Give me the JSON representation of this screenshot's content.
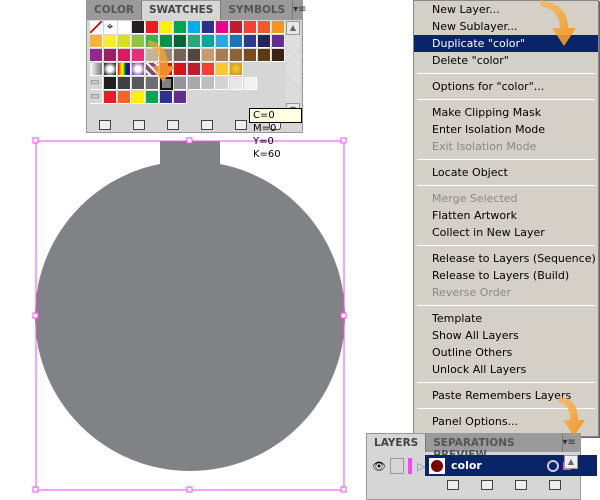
{
  "swatches_panel": {
    "tabs": [
      {
        "label": "COLOR"
      },
      {
        "label": "SWATCHES"
      },
      {
        "label": "SYMBOLS"
      }
    ],
    "active_tab": "SWATCHES",
    "menu_icon": "panel-menu-icon",
    "rows": [
      [
        "none",
        "registration",
        "#ffffff",
        "#231f20",
        "#ed1c24",
        "#fff200",
        "#00a651",
        "#00aeef",
        "#2e3192",
        "#ec008c",
        "#be1e2d",
        "#ef4136",
        "#f15a29",
        "#f7941d"
      ],
      [
        "#fbb040",
        "#f9ed32",
        "#d7df23",
        "#8dc63f",
        "#39b54a",
        "#009444",
        "#006838",
        "#27aa75",
        "#00a79d",
        "#27aae1",
        "#1c75bc",
        "#2b3990",
        "#262262",
        "#662d91"
      ],
      [
        "#92278f",
        "#9e1f63",
        "#da1c5c",
        "#ee2a7b",
        "#c2b59b",
        "#998675",
        "#736357",
        "#534741",
        "#c69c6d",
        "#a67c52",
        "#8c6239",
        "#754c24",
        "#603913",
        "#3c2415"
      ],
      [
        "gradient-fade",
        "gradient-radial",
        "gradient-rainbow",
        "gradient-purple",
        "pattern",
        "#c4161c",
        "#d7141a",
        "#be1e2d",
        "#ef4136",
        "#fdc82f",
        "gradient-gold"
      ],
      [
        "folder",
        "#231f20",
        "#414042",
        "#58595b",
        "#6d6e71",
        "#808285",
        "#939598",
        "#a7a9ac",
        "#bcbec0",
        "#d1d3d4",
        "#e6e7e8",
        "#f1f2f2"
      ],
      [
        "folder",
        "#ed1c24",
        "#f26522",
        "#fff200",
        "#00a651",
        "#2e3192",
        "#662d91"
      ]
    ],
    "selected_swatch": "#808285",
    "tooltip": "C=0 M=0 Y=0 K=60"
  },
  "context_menu": {
    "items": [
      {
        "label": "New Layer..."
      },
      {
        "label": "New Sublayer..."
      },
      {
        "label": "Duplicate \"color\"",
        "highlighted": true
      },
      {
        "label": "Delete \"color\""
      },
      {
        "sep": true
      },
      {
        "label": "Options for \"color\"..."
      },
      {
        "sep": true
      },
      {
        "label": "Make Clipping Mask"
      },
      {
        "label": "Enter Isolation Mode"
      },
      {
        "label": "Exit Isolation Mode",
        "disabled": true
      },
      {
        "sep": true
      },
      {
        "label": "Locate Object"
      },
      {
        "sep": true
      },
      {
        "label": "Merge Selected",
        "disabled": true
      },
      {
        "label": "Flatten Artwork"
      },
      {
        "label": "Collect in New Layer"
      },
      {
        "sep": true
      },
      {
        "label": "Release to Layers (Sequence)"
      },
      {
        "label": "Release to Layers (Build)"
      },
      {
        "label": "Reverse Order",
        "disabled": true
      },
      {
        "sep": true
      },
      {
        "label": "Template"
      },
      {
        "label": "Show All Layers"
      },
      {
        "label": "Outline Others"
      },
      {
        "label": "Unlock All Layers"
      },
      {
        "sep": true
      },
      {
        "label": "Paste Remembers Layers"
      },
      {
        "sep": true
      },
      {
        "label": "Panel Options..."
      }
    ]
  },
  "layers_panel": {
    "tabs": [
      {
        "label": "LAYERS"
      },
      {
        "label": "SEPARATIONS PREVIEW"
      }
    ],
    "layer": {
      "name": "color",
      "color": "#ff44ff",
      "thumb_color": "#7a0000"
    }
  },
  "artwork": {
    "fill": "#808285",
    "selection_color": "#ff44ff"
  },
  "colors": {
    "accent": "#f7941d",
    "highlight": "#0a246a"
  }
}
